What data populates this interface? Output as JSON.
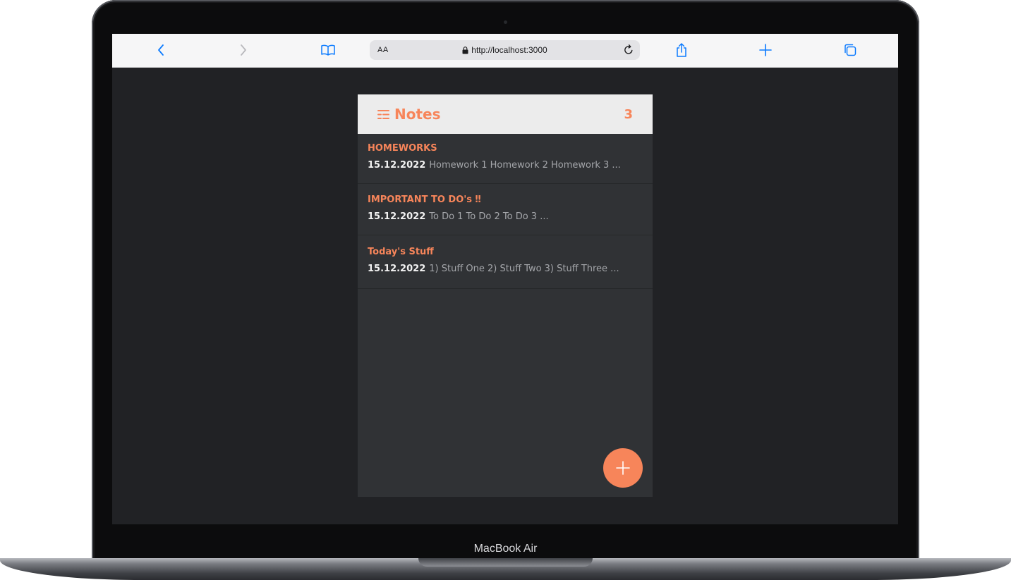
{
  "browser": {
    "aa_label": "AA",
    "url": "http://localhost:3000"
  },
  "app": {
    "title": "Notes",
    "count": "3",
    "notes": [
      {
        "title": "HOMEWORKS",
        "date": "15.12.2022",
        "preview": "Homework 1 Homework 2 Homework 3 ..."
      },
      {
        "title": "IMPORTANT TO DO's ‼",
        "date": "15.12.2022",
        "preview": "To Do 1 To Do 2 To Do 3 ..."
      },
      {
        "title": "Today's Stuff",
        "date": "15.12.2022",
        "preview": "1) Stuff One 2) Stuff Two 3) Stuff Three ..."
      }
    ]
  },
  "device": {
    "label": "MacBook Air"
  },
  "colors": {
    "accent": "#f7855a",
    "app_bg": "#303235",
    "page_bg": "#212225",
    "header_bg": "#ececec",
    "browser_blue": "#0a7aff"
  },
  "icons": [
    "back-icon",
    "forward-icon",
    "bookmarks-icon",
    "lock-icon",
    "reload-icon",
    "share-icon",
    "new-tab-icon",
    "tabs-icon",
    "notes-list-icon",
    "plus-icon"
  ]
}
